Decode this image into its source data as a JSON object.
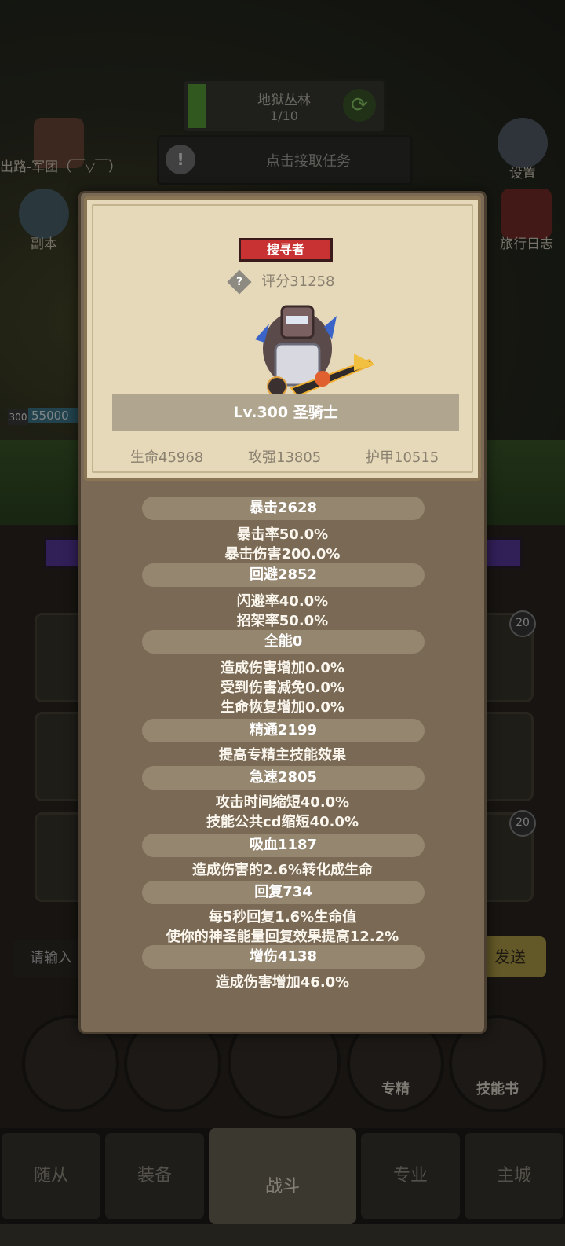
{
  "background": {
    "stage": {
      "name": "地狱丛林",
      "progress": "1/10",
      "progress_fraction": 0.1
    },
    "quest": {
      "label": "点击接取任务"
    },
    "side_left": [
      {
        "label": "出路-军团（￣▽￣）"
      },
      {
        "label": "副本"
      }
    ],
    "side_right": [
      {
        "label": "设置"
      },
      {
        "label": "旅行日志"
      }
    ],
    "hero_level": "300",
    "hero_hp": "55000",
    "slot_badges": [
      "20",
      "20"
    ],
    "chat": {
      "placeholder": "请输入",
      "send_label": "发送"
    },
    "circle_buttons": [
      {
        "label": ""
      },
      {
        "label": ""
      },
      {
        "label": ""
      },
      {
        "label": "专精"
      },
      {
        "label": "技能书"
      }
    ],
    "nav_tabs": [
      {
        "label": "随从"
      },
      {
        "label": "装备"
      },
      {
        "label": "战斗"
      },
      {
        "label": "专业"
      },
      {
        "label": "主城"
      }
    ]
  },
  "popup": {
    "tag": "搜寻者",
    "score_label": "评分31258",
    "name": "Lv.300 圣骑士",
    "stats": {
      "hp": "生命45968",
      "attack": "攻强13805",
      "armor": "护甲10515"
    },
    "attributes": [
      {
        "header": "暴击2628",
        "lines": [
          "暴击率50.0%",
          "暴击伤害200.0%"
        ]
      },
      {
        "header": "回避2852",
        "lines": [
          "闪避率40.0%",
          "招架率50.0%"
        ]
      },
      {
        "header": "全能0",
        "lines": [
          "造成伤害增加0.0%",
          "受到伤害减免0.0%",
          "生命恢复增加0.0%"
        ]
      },
      {
        "header": "精通2199",
        "lines": [
          "提高专精主技能效果"
        ]
      },
      {
        "header": "急速2805",
        "lines": [
          "攻击时间缩短40.0%",
          "技能公共cd缩短40.0%"
        ]
      },
      {
        "header": "吸血1187",
        "lines": [
          "造成伤害的2.6%转化成生命"
        ]
      },
      {
        "header": "回复734",
        "lines": [
          "每5秒回复1.6%生命值",
          "使你的神圣能量回复效果提高12.2%"
        ]
      },
      {
        "header": "增伤4138",
        "lines": [
          "造成伤害增加46.0%"
        ]
      }
    ]
  }
}
